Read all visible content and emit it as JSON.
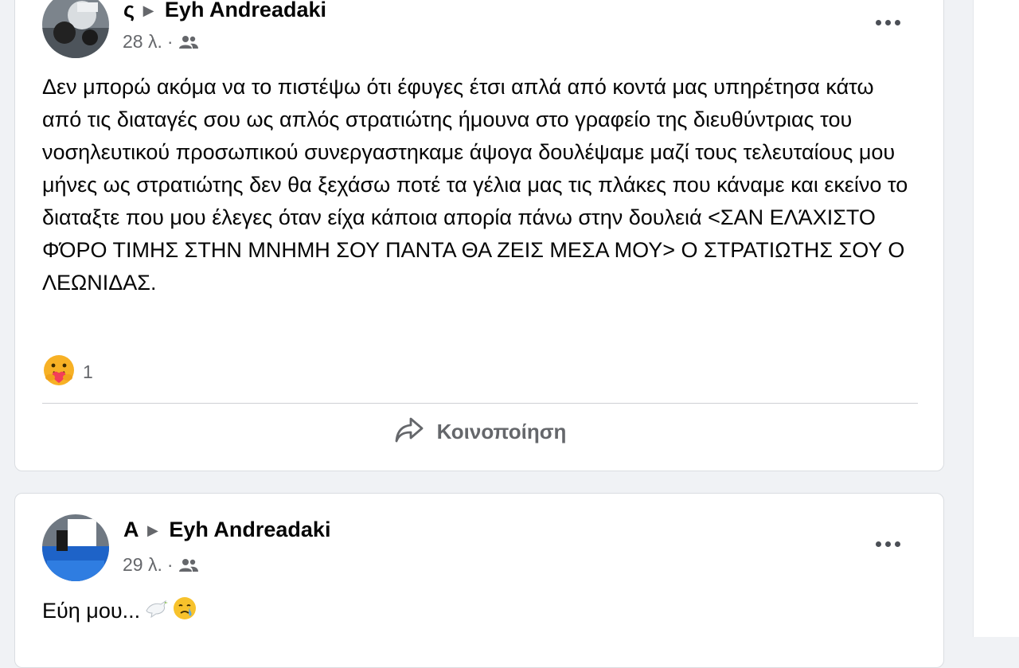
{
  "posts": [
    {
      "author_visible": "ς",
      "target": "Eyh Andreadaki",
      "time": "28 λ.",
      "audience_icon": "friends-icon",
      "text": "Δεν μπορώ ακόμα να το πιστέψω ότι έφυγες έτσι απλά από κοντά μας υπηρέτησα κάτω από τις διαταγές σου ως απλός στρατιώτης ήμουνα στο γραφείο της διευθύντριας του νοσηλευτικού προσωπικού συνεργαστηκαμε άψογα δουλέψαμε μαζί τους τελευταίους μου μήνες ως στρατιώτης δεν θα ξεχάσω ποτέ τα γέλια μας τις πλάκες που κάναμε και εκείνο το διαταξτε που μου έλεγες όταν είχα κάποια απορία πάνω στην δουλειά <ΣΑΝ ΕΛΆΧΙΣΤΟ ΦΌΡΟ ΤΙΜΗΣ ΣΤΗΝ ΜΝΗΜΗ ΣΟΥ ΠΑΝΤΑ ΘΑ ΖΕΙΣ ΜΕΣΑ ΜΟΥ> Ο ΣΤΡΑΤΙΩΤΗΣ ΣΟΥ Ο ΛΕΩΝΙΔΑΣ.",
      "reaction_icon": "care-reaction-icon",
      "reaction_count": "1",
      "share_label": "Κοινοποίηση"
    },
    {
      "author_visible": "Α",
      "target": "Eyh Andreadaki",
      "time": "29 λ.",
      "audience_icon": "friends-icon",
      "text": "Εύη μου...",
      "emojis": [
        "dove-icon",
        "crying-face-icon"
      ]
    }
  ],
  "colors": {
    "background": "#f0f2f5",
    "card": "#ffffff",
    "secondary_text": "#65676b",
    "reaction_yellow": "#f7b125",
    "reaction_heart": "#f33e58"
  }
}
